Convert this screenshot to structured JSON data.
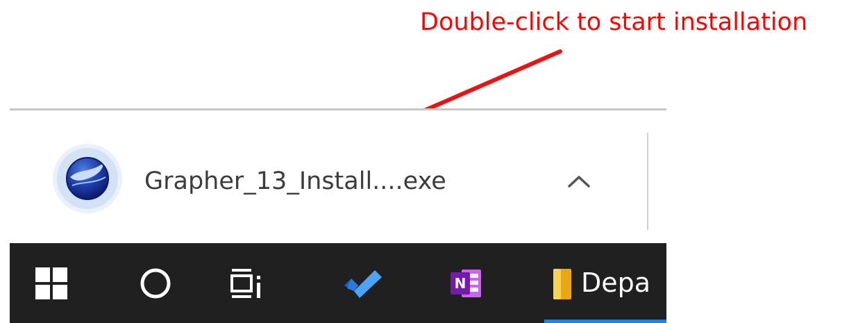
{
  "annotation": {
    "text": "Double-click to start installation",
    "color": "#ff0000"
  },
  "download_bar": {
    "file_name": "Grapher_13_Install....exe",
    "file_icon": "grapher-app-icon",
    "menu_icon": "chevron-up-icon"
  },
  "taskbar": {
    "items": [
      {
        "icon": "windows-start-icon"
      },
      {
        "icon": "cortana-search-icon"
      },
      {
        "icon": "task-view-icon"
      },
      {
        "icon": "todo-checkmark-icon"
      },
      {
        "icon": "onenote-icon"
      },
      {
        "icon": "file-explorer-folder-icon",
        "label": "Depa"
      }
    ],
    "background": "#202020",
    "active_accent": "#2b7fd5"
  }
}
